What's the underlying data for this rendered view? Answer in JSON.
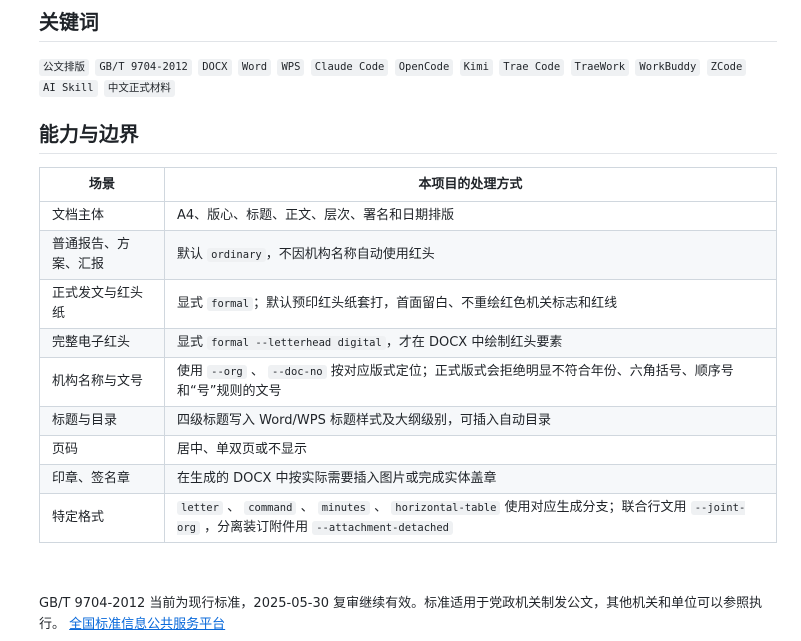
{
  "section_keywords": {
    "title": "关键词",
    "tags": [
      "公文排版",
      "GB/T 9704-2012",
      "DOCX",
      "Word",
      "WPS",
      "Claude Code",
      "OpenCode",
      "Kimi",
      "Trae Code",
      "TraeWork",
      "WorkBuddy",
      "ZCode",
      "AI Skill",
      "中文正式材料"
    ]
  },
  "section_capability": {
    "title": "能力与边界",
    "table": {
      "headers": [
        "场景",
        "本项目的处理方式"
      ],
      "rows": [
        {
          "scene": "文档主体",
          "text": "A4、版心、标题、正文、层次、署名和日期排版"
        },
        {
          "scene": "普通报告、方案、汇报",
          "pre": "默认 ",
          "code": "ordinary",
          "post": "，不因机构名称自动使用红头"
        },
        {
          "scene": "正式发文与红头纸",
          "pre": "显式 ",
          "code": "formal",
          "post": "；默认预印红头纸套打，首面留白、不重绘红色机关标志和红线"
        },
        {
          "scene": "完整电子红头",
          "pre": "显式 ",
          "code": "formal --letterhead digital",
          "post": "，才在 DOCX 中绘制红头要素"
        },
        {
          "scene": "机构名称与文号",
          "pre": "使用 ",
          "code": "--org",
          "mid": " 、 ",
          "code2": "--doc-no",
          "post": " 按对应版式定位；正式版式会拒绝明显不符合年份、六角括号、顺序号和“号”规则的文号"
        },
        {
          "scene": "标题与目录",
          "text": "四级标题写入 Word/WPS 标题样式及大纲级别，可插入自动目录"
        },
        {
          "scene": "页码",
          "text": "居中、单双页或不显示"
        },
        {
          "scene": "印章、签名章",
          "text": "在生成的 DOCX 中按实际需要插入图片或完成实体盖章"
        },
        {
          "scene": "特定格式",
          "c1": "letter",
          "s1": " 、 ",
          "c2": "command",
          "s2": " 、 ",
          "c3": "minutes",
          "s3": " 、 ",
          "c4": "horizontal-table",
          "s4": " 使用对应生成分支；联合行文用 ",
          "c5": "--joint-org",
          "s5": " ，分离装订附件用 ",
          "c6": "--attachment-detached"
        }
      ]
    }
  },
  "footer": {
    "text": "GB/T 9704-2012 当前为现行标准，2025-05-30 复审继续有效。标准适用于党政机关制发公文，其他机关和单位可以参照执行。",
    "link": "全国标准信息公共服务平台"
  }
}
